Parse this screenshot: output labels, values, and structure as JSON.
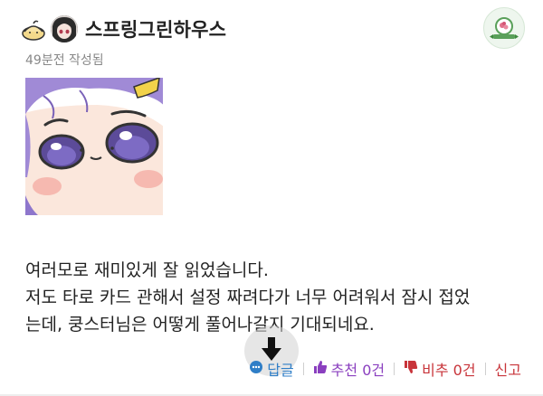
{
  "author": {
    "nickname": "스프링그린하우스",
    "time_ago": "49분전 작성됨",
    "level_icon": "bun-level-icon",
    "avatar": "profile-avatar-icon",
    "badge_icon": "greenhouse-badge-icon"
  },
  "sticker": {
    "icon": "purple-hair-character-sticker"
  },
  "comment": {
    "lines": [
      "여러모로 재미있게 잘 읽었습니다.",
      "저도 타로 카드 관해서 설정 짜려다가 너무 어려워서 잠시 접었",
      "는데, 쿵스터님은 어떻게 풀어나갈지 기대되네요."
    ]
  },
  "actions": {
    "reply_label": "답글",
    "like_label": "추천 0건",
    "dislike_label": "비추 0건",
    "report_label": "신고"
  },
  "overlay": {
    "scroll_icon": "down-arrow-icon"
  },
  "colors": {
    "reply": "#2f7ec7",
    "like": "#8a3fbf",
    "dislike": "#c8343a",
    "time": "#888888"
  }
}
